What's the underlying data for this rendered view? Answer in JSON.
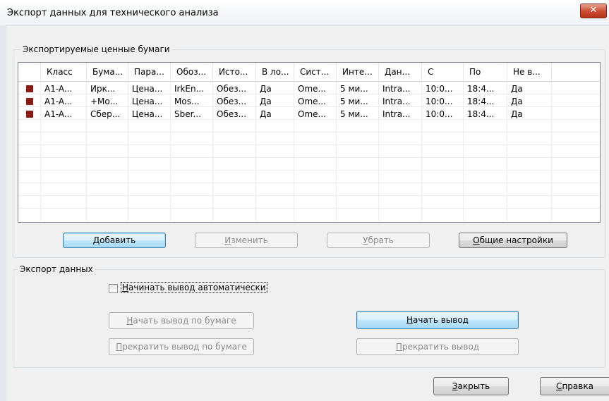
{
  "window": {
    "title": "Экспорт данных для технического анализа",
    "close_glyph": "✕"
  },
  "securities": {
    "legend": "Экспортируемые ценные бумаги",
    "columns": [
      "",
      "Класс",
      "Бума...",
      "Пара...",
      "Обоз...",
      "Исто...",
      "В ло...",
      "Сист...",
      "Инте...",
      "Дан...",
      "С",
      "По",
      "Не в..."
    ],
    "rows": [
      {
        "color": "#8b1a14",
        "cells": [
          "A1-A...",
          "Ирк...",
          "Цена...",
          "IrkEn...",
          "Обез...",
          "Да",
          "Ome...",
          "5 ми...",
          "Intra...",
          "10:0...",
          "18:4...",
          "Да"
        ]
      },
      {
        "color": "#8b1a14",
        "cells": [
          "A1-A...",
          "+Мо...",
          "Цена...",
          "Mos...",
          "Обез...",
          "Да",
          "Ome...",
          "5 ми...",
          "Intra...",
          "10:0...",
          "18:4...",
          "Да"
        ]
      },
      {
        "color": "#8b1a14",
        "cells": [
          "A1-A...",
          "Сбер...",
          "Цена...",
          "Sber...",
          "Обез...",
          "Да",
          "Ome...",
          "5 ми...",
          "Intra...",
          "10:0...",
          "18:4...",
          "Да"
        ]
      }
    ],
    "buttons": {
      "add": {
        "mn": "Д",
        "rest": "обавить"
      },
      "edit": {
        "mn": "И",
        "rest": "зменить"
      },
      "remove": {
        "mn": "У",
        "rest": "брать"
      },
      "general": {
        "mn": "О",
        "rest": "бщие настройки"
      }
    }
  },
  "export": {
    "legend": "Экспорт данных",
    "auto_start": {
      "mn": "Н",
      "rest": "ачинать вывод автоматически",
      "checked": false
    },
    "start_by_security": {
      "mn": "Н",
      "rest": "ачать вывод по бумаге"
    },
    "stop_by_security": {
      "mn": "П",
      "rest": "рекратить вывод по бумаге"
    },
    "start_output": {
      "mn": "Н",
      "rest": "ачать вывод"
    },
    "stop_output": {
      "mn": "П",
      "rest": "рекратить вывод"
    }
  },
  "footer": {
    "close": {
      "mn": "З",
      "rest": "акрыть"
    },
    "help": {
      "mn": "С",
      "rest": "правка"
    }
  }
}
